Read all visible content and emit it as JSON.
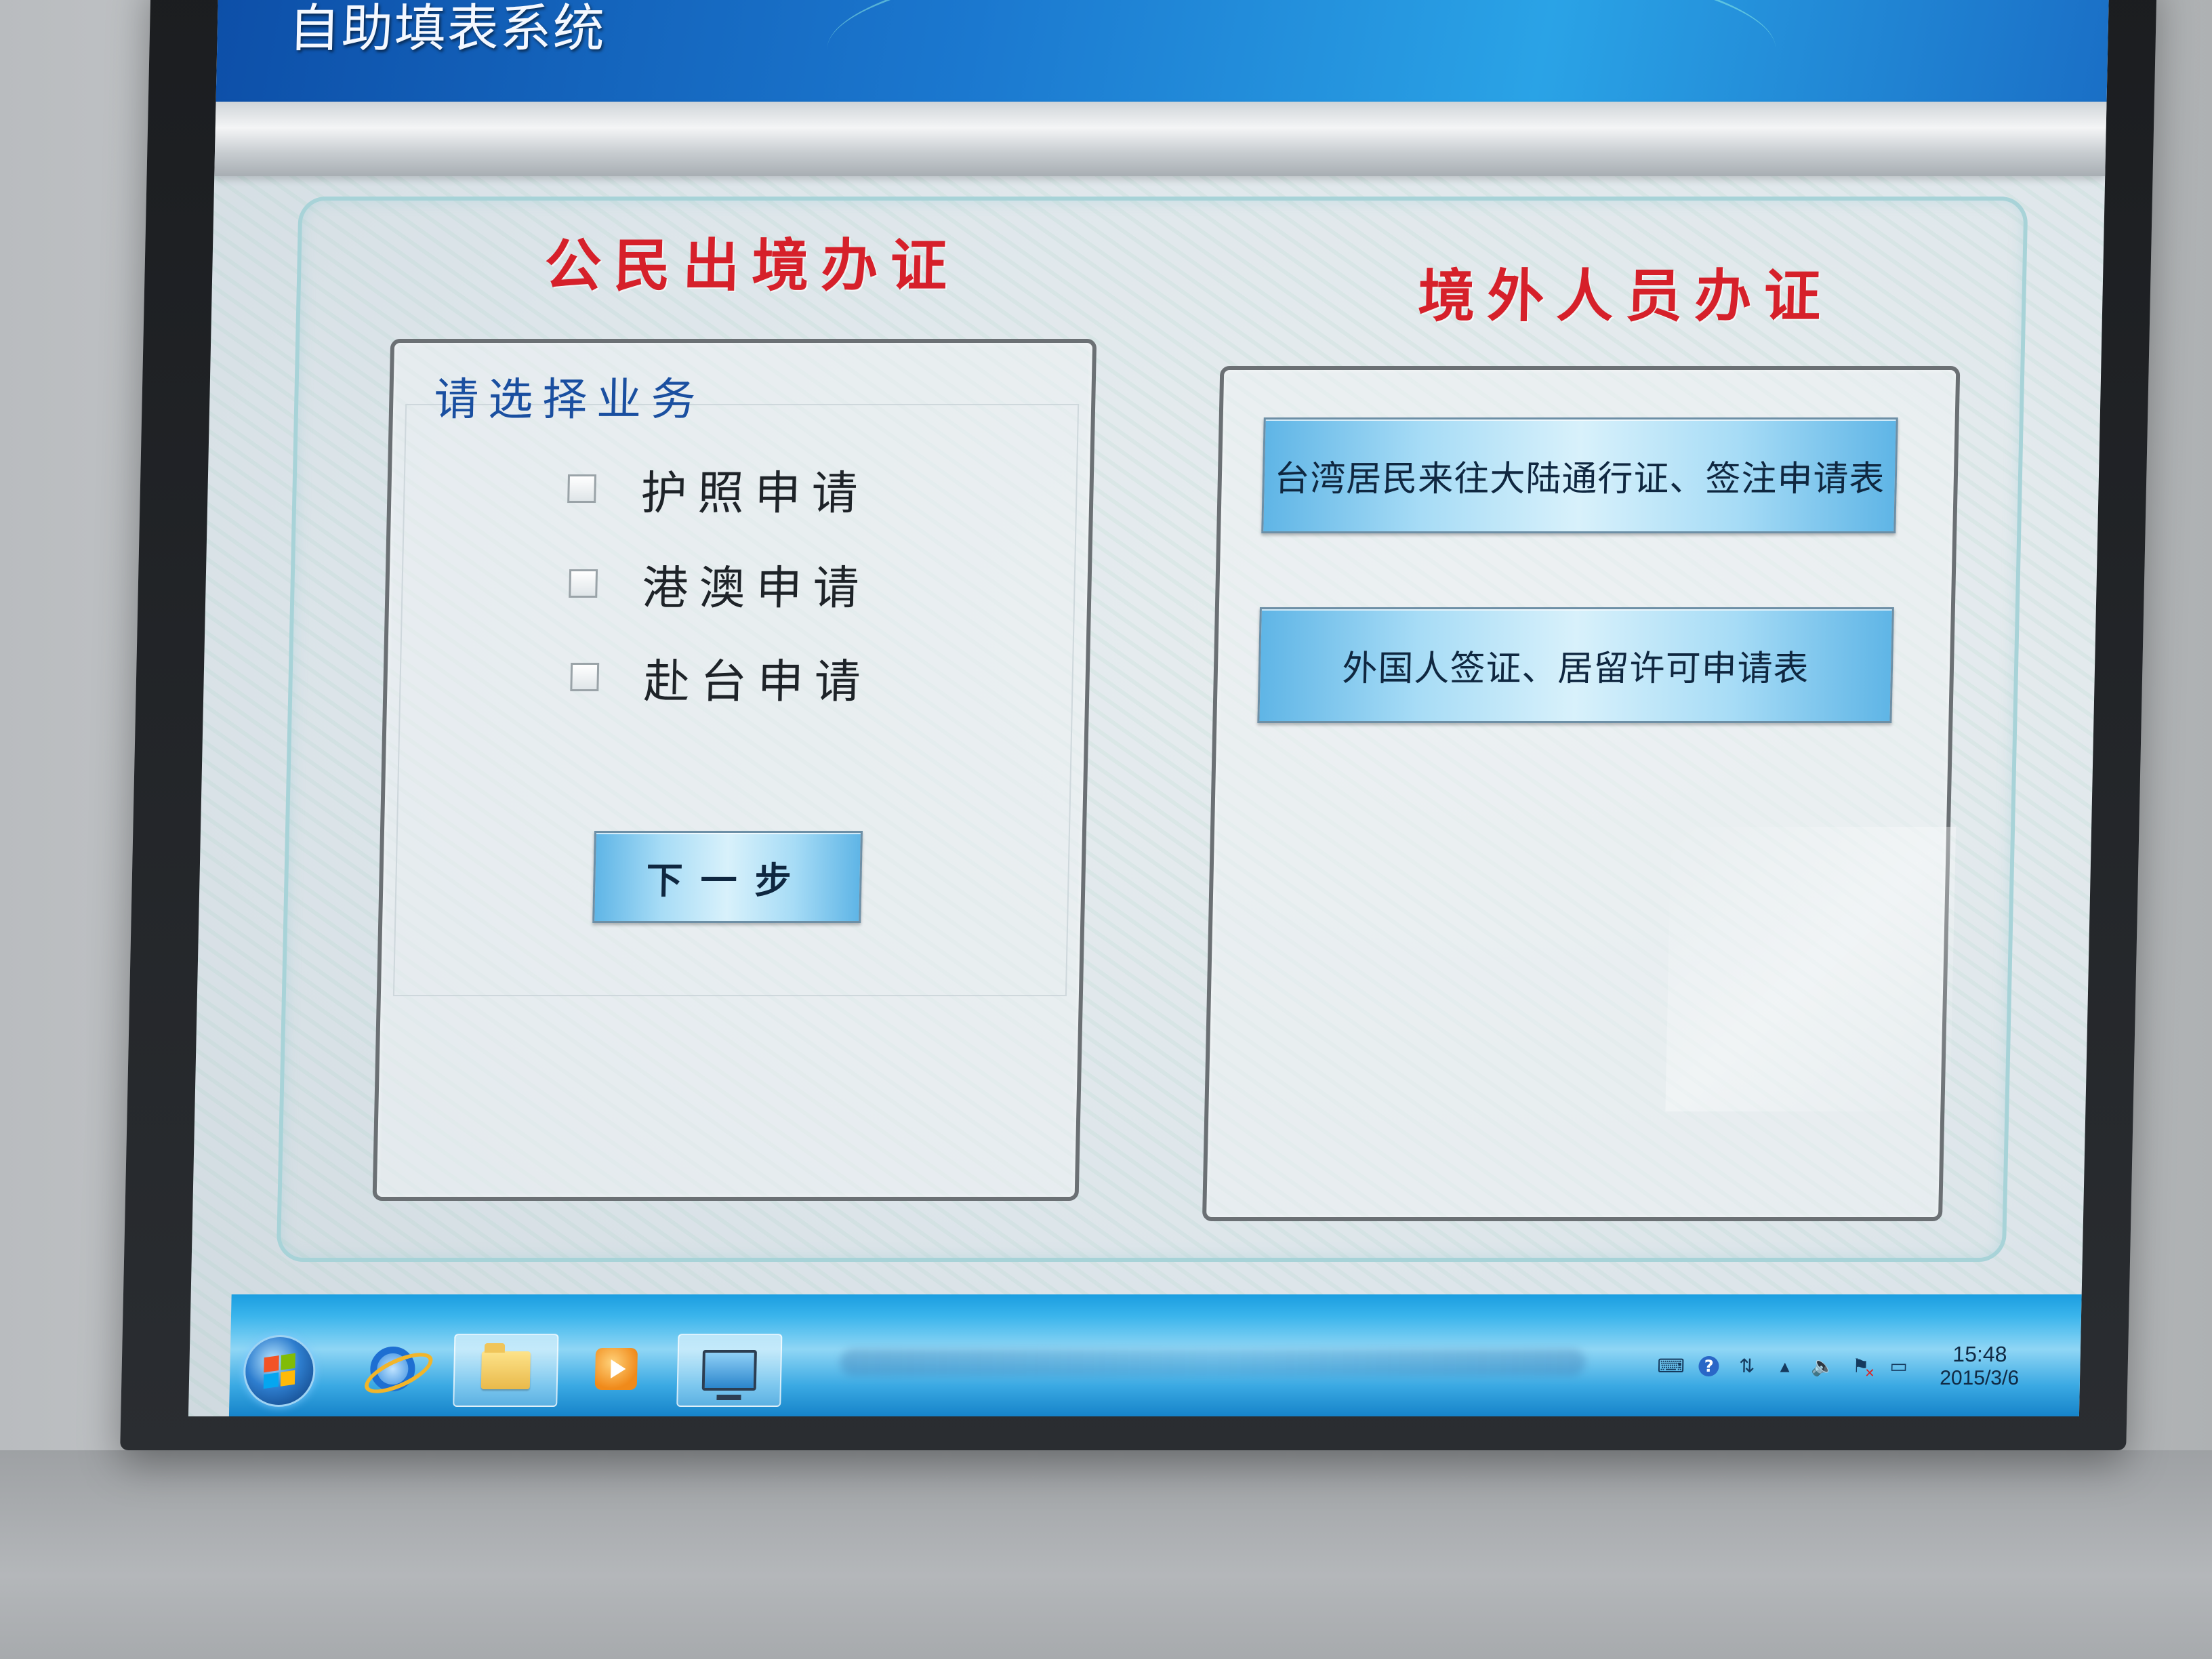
{
  "header": {
    "title": "自助填表系统"
  },
  "citizen_section": {
    "title": "公民出境办证",
    "prompt": "请选择业务",
    "options": [
      {
        "label": "护照申请",
        "checked": false
      },
      {
        "label": "港澳申请",
        "checked": false
      },
      {
        "label": "赴台申请",
        "checked": false
      }
    ],
    "next_label": "下一步"
  },
  "foreign_section": {
    "title": "境外人员办证",
    "buttons": [
      {
        "label": "台湾居民来往大陆通行证、签注申请表"
      },
      {
        "label": "外国人签证、居留许可申请表"
      }
    ]
  },
  "taskbar": {
    "pinned": [
      {
        "icon": "ie-icon"
      },
      {
        "icon": "folder-icon"
      },
      {
        "icon": "media-player-icon"
      },
      {
        "icon": "monitor-icon"
      }
    ],
    "tray": {
      "icons": [
        "keyboard-icon",
        "help-icon",
        "network-icon",
        "show-hidden-icon",
        "volume-icon",
        "action-center-icon",
        "power-icon"
      ]
    },
    "clock": {
      "time": "15:48",
      "date": "2015/3/6"
    }
  },
  "colors": {
    "section_title": "#d6202a",
    "prompt_text": "#1a4fa0",
    "header_blue": "#1b78cf",
    "button_blue": "#a7dcf6"
  }
}
